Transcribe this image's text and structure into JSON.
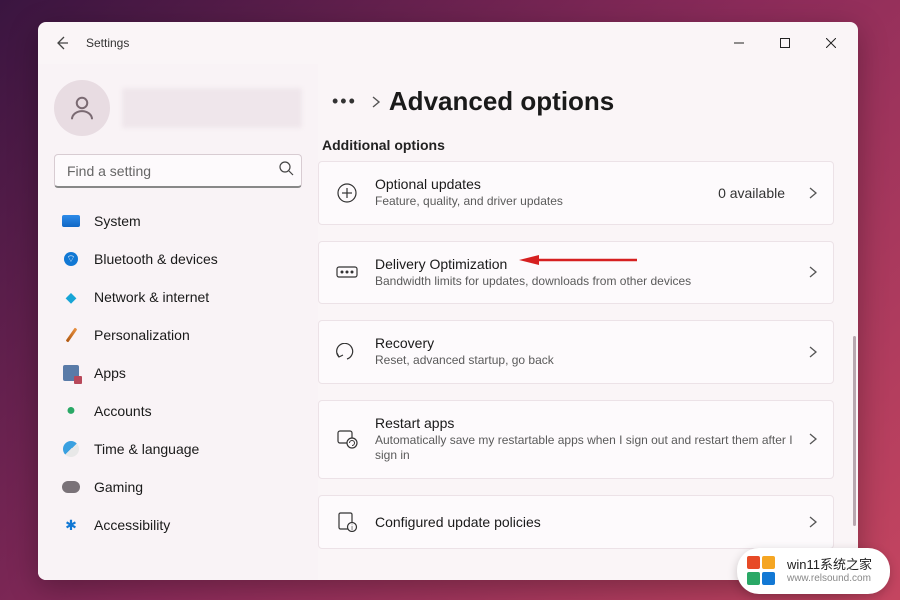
{
  "window": {
    "title": "Settings"
  },
  "search": {
    "placeholder": "Find a setting"
  },
  "nav": [
    {
      "label": "System",
      "icon": "system"
    },
    {
      "label": "Bluetooth & devices",
      "icon": "bt"
    },
    {
      "label": "Network & internet",
      "icon": "net"
    },
    {
      "label": "Personalization",
      "icon": "pers"
    },
    {
      "label": "Apps",
      "icon": "apps"
    },
    {
      "label": "Accounts",
      "icon": "acc"
    },
    {
      "label": "Time & language",
      "icon": "time"
    },
    {
      "label": "Gaming",
      "icon": "game"
    },
    {
      "label": "Accessibility",
      "icon": "access"
    }
  ],
  "page": {
    "title": "Advanced options",
    "section_label": "Additional options"
  },
  "cards": [
    {
      "title": "Optional updates",
      "sub": "Feature, quality, and driver updates",
      "extra": "0 available"
    },
    {
      "title": "Delivery Optimization",
      "sub": "Bandwidth limits for updates, downloads from other devices"
    },
    {
      "title": "Recovery",
      "sub": "Reset, advanced startup, go back"
    },
    {
      "title": "Restart apps",
      "sub": "Automatically save my restartable apps when I sign out and restart them after I sign in"
    },
    {
      "title": "Configured update policies"
    }
  ],
  "watermark": {
    "line1": "win11系统之家",
    "line2": "www.relsound.com"
  },
  "colors": {
    "accent": "#1278d4",
    "card_border": "#ece2e7",
    "bg": "#faf5f7"
  }
}
